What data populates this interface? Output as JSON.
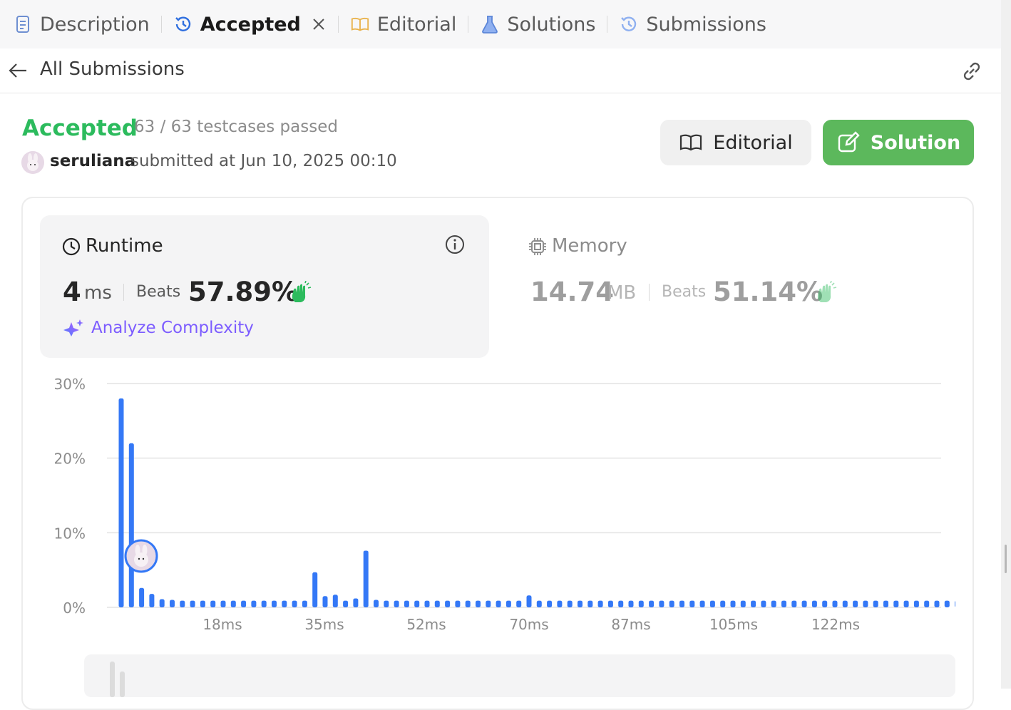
{
  "tabs": [
    {
      "label": "Description",
      "icon": "description-icon",
      "active": false
    },
    {
      "label": "Accepted",
      "icon": "history-icon",
      "active": true,
      "closable": true
    },
    {
      "label": "Editorial",
      "icon": "book-icon",
      "active": false
    },
    {
      "label": "Solutions",
      "icon": "flask-icon",
      "active": false
    },
    {
      "label": "Submissions",
      "icon": "history-icon",
      "active": false
    }
  ],
  "subheader": {
    "title": "All Submissions",
    "back_icon": "arrow-left-icon",
    "link_icon": "link-icon"
  },
  "result": {
    "status": "Accepted",
    "testcases": "63 / 63 testcases passed",
    "username": "seruliana",
    "submitted": "submitted at Jun 10, 2025 00:10"
  },
  "buttons": {
    "editorial": "Editorial",
    "solution": "Solution"
  },
  "runtime": {
    "label": "Runtime",
    "value": "4",
    "unit": "ms",
    "beats_label": "Beats",
    "beats_value": "57.89%",
    "analyze": "Analyze Complexity"
  },
  "memory": {
    "label": "Memory",
    "value": "14.74",
    "unit": "MB",
    "beats_label": "Beats",
    "beats_value": "51.14%"
  },
  "colors": {
    "accent_green": "#2cbb5d",
    "button_green": "#5cb85c",
    "bar_blue": "#3478f6",
    "purple": "#7c5cff"
  },
  "chart_data": {
    "type": "bar",
    "ylabel": "",
    "xlabel": "",
    "ylim": [
      0,
      30
    ],
    "yticks": [
      "30%",
      "20%",
      "10%",
      "0%"
    ],
    "xticks": [
      "18ms",
      "35ms",
      "52ms",
      "70ms",
      "87ms",
      "105ms",
      "122ms"
    ],
    "highlight_index": 2,
    "values": [
      28,
      22,
      2.6,
      1.8,
      1.1,
      1.0,
      0.9,
      0.9,
      0.9,
      0.9,
      0.9,
      0.9,
      0.9,
      0.9,
      0.9,
      0.9,
      0.9,
      0.9,
      0.9,
      4.7,
      1.5,
      1.7,
      0.9,
      1.2,
      7.6,
      1.0,
      0.9,
      0.9,
      0.9,
      0.9,
      0.9,
      0.9,
      0.9,
      0.9,
      0.9,
      0.9,
      0.9,
      0.9,
      0.9,
      0.9,
      1.6,
      0.9,
      0.9,
      0.9,
      0.9,
      0.9,
      0.9,
      0.9,
      0.9,
      0.9,
      0.9,
      0.9,
      0.9,
      0.9,
      0.9,
      0.9,
      0.9,
      0.9,
      0.9,
      0.9,
      0.9,
      0.9,
      0.9,
      0.9,
      0.9,
      0.9,
      0.9,
      0.9,
      0.9,
      0.9,
      0.9,
      0.9,
      0.9,
      0.9,
      0.9,
      0.9,
      0.9,
      0.9,
      0.9,
      0.9,
      0.9,
      0.9,
      0.9
    ]
  }
}
